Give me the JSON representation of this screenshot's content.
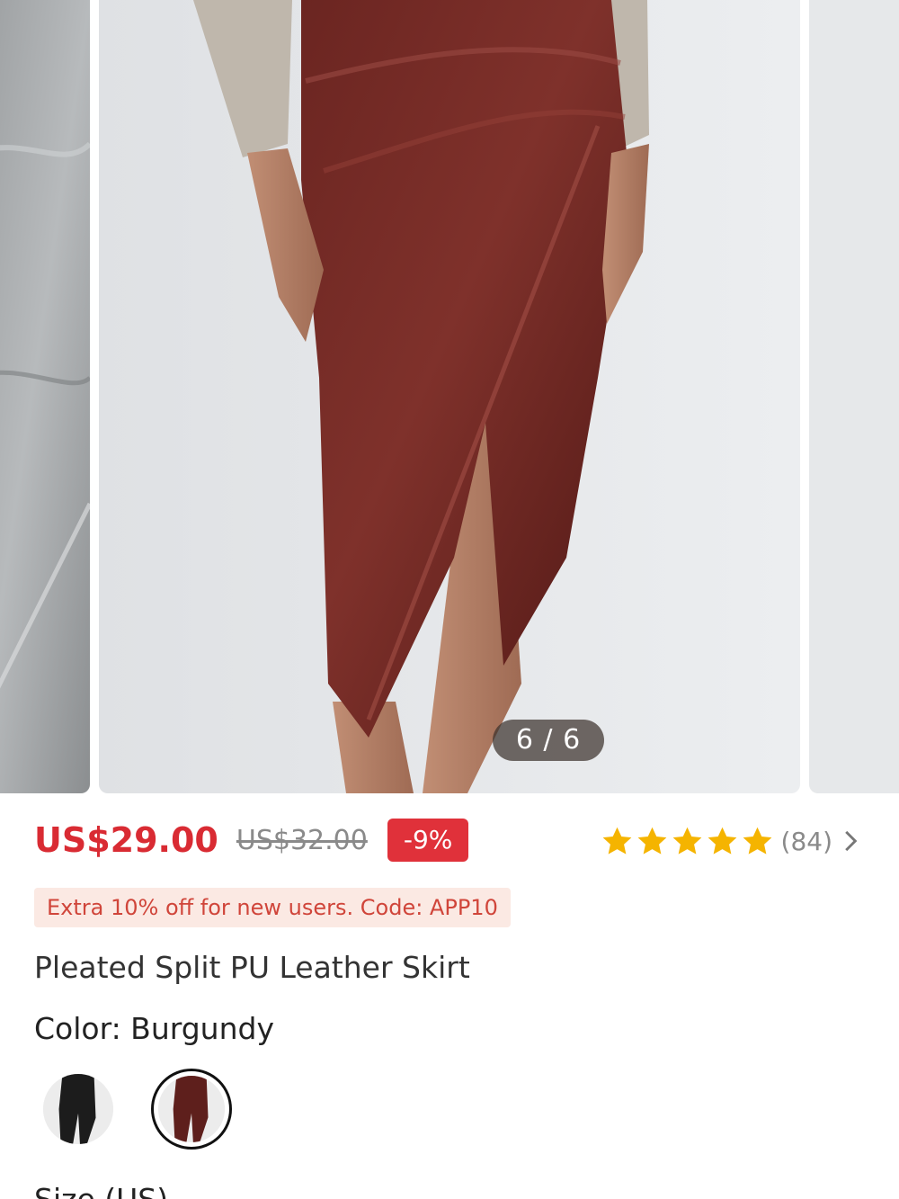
{
  "gallery": {
    "counter": "6 / 6"
  },
  "pricing": {
    "current_price": "US$29.00",
    "original_price": "US$32.00",
    "discount": "-9%"
  },
  "rating": {
    "stars": 5,
    "count": "(84)"
  },
  "promo": {
    "text": "Extra 10% off for new users. Code: APP10"
  },
  "product": {
    "title": "Pleated Split PU Leather Skirt",
    "color_label": "Color: Burgundy",
    "size_label": "Size (US)"
  },
  "color_options": [
    {
      "name": "Black",
      "swatch": "#1c1c1c",
      "selected": false
    },
    {
      "name": "Burgundy",
      "swatch": "#5e1f1c",
      "selected": true
    }
  ],
  "colors": {
    "price_red": "#d92b33",
    "badge_red": "#e0313a",
    "star_gold": "#f5b400",
    "promo_bg": "#fbe9e3",
    "promo_text": "#d0453a"
  }
}
